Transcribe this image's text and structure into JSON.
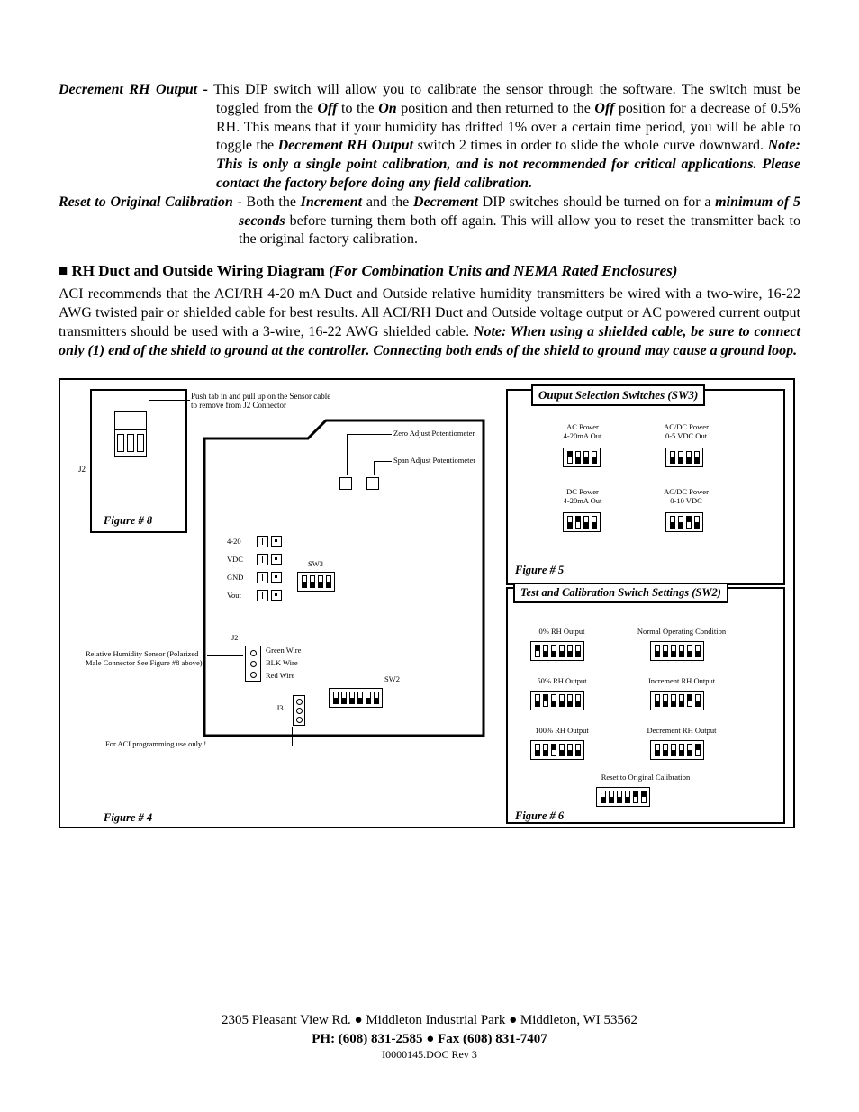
{
  "p1": {
    "label": "Decrement RH Output -",
    "t1": " This DIP switch will allow you to calibrate the sensor through the software.  The switch must be toggled from the ",
    "off1": "Off",
    "t2": " to the ",
    "on1": "On",
    "t3": " position and then returned to the ",
    "off2": "Off",
    "t4": " position for a decrease of 0.5% RH.  This means that if your humidity has drifted 1% over a certain time period, you will be able to toggle the ",
    "dec": "Decrement RH Output",
    "t5": " switch 2 times in order to slide the whole curve downward.  ",
    "note": "Note:  This is only a single point calibration, and is not recommended for critical applications.  Please contact the factory before doing any field  calibration."
  },
  "p2": {
    "label": "Reset to Original Calibration -",
    "t1": " Both the ",
    "inc": "Increment",
    "t2": " and the ",
    "dec": "Decrement",
    "t3": " DIP switches should be turned on for a ",
    "min": "minimum of 5 seconds",
    "t4": " before turning them both off again.  This will allow you to reset the transmitter back to the original factory calibration."
  },
  "heading": {
    "bullet": "■",
    "title": " RH Duct and Outside Wiring Diagram ",
    "sub": "(For Combination Units and NEMA Rated Enclosures)"
  },
  "p3": {
    "t1": "ACI recommends that the ACI/RH 4-20 mA Duct and Outside relative humidity transmitters be wired with a two-wire, 16-22 AWG twisted pair or shielded cable for best results.  All ACI/RH Duct and Outside voltage output or AC powered current output transmitters should be used with a 3-wire, 16-22 AWG shielded cable.  ",
    "note": "Note:  When using a shielded cable, be sure to connect only (1) end of the shield to ground at the controller.  Connecting both ends of the shield to ground may cause a ground loop."
  },
  "diagram": {
    "push_tab": "Push tab in and pull up on the Sensor cable to remove from J2 Connector",
    "zero": "Zero Adjust Potentiometer",
    "span": "Span Adjust Potentiometer",
    "j2": "J2",
    "fig8": "Figure # 8",
    "t420": "4-20",
    "vdc": "VDC",
    "gnd": "GND",
    "vout": "Vout",
    "sw3": "SW3",
    "sw2": "SW2",
    "j3": "J3",
    "green": "Green Wire",
    "blk": "BLK Wire",
    "red": "Red Wire",
    "rh_sensor": "Relative Humidity Sensor (Polarized Male Connector See Figure #8 above)",
    "aci_prog": "For ACI programming use only !",
    "fig4": "Figure # 4",
    "panel5": {
      "title": "Output Selection Switches (SW3)",
      "r1c1a": "AC Power",
      "r1c1b": "4-20mA Out",
      "r1c2a": "AC/DC Power",
      "r1c2b": "0-5 VDC Out",
      "r2c1a": "DC Power",
      "r2c1b": "4-20mA Out",
      "r2c2a": "AC/DC Power",
      "r2c2b": "0-10 VDC",
      "fig": "Figure # 5"
    },
    "panel6": {
      "title": "Test and Calibration Switch Settings (SW2)",
      "r1c1": "0% RH Output",
      "r1c2": "Normal Operating Condition",
      "r2c1": "50% RH Output",
      "r2c2": "Increment RH Output",
      "r3c1": "100% RH Output",
      "r3c2": "Decrement RH Output",
      "reset": "Reset to Original Calibration",
      "fig": "Figure # 6"
    }
  },
  "footer": {
    "addr1": "2305 Pleasant View Rd. ",
    "addr2": " Middleton Industrial Park ",
    "addr3": " Middleton, WI 53562",
    "ph": "PH: (608) 831-2585 ",
    "fax": " Fax (608) 831-7407",
    "rev": "I0000145.DOC Rev 3"
  },
  "chart_data": {
    "type": "table",
    "title": "DIP Switch Reference (SW3 Output Selection & SW2 Test/Calibration)",
    "sw3_outputs_4position": [
      {
        "label": "AC Power 4-20mA Out",
        "positions": [
          "up",
          "dn",
          "dn",
          "dn"
        ]
      },
      {
        "label": "AC/DC Power 0-5 VDC Out",
        "positions": [
          "dn",
          "dn",
          "dn",
          "dn"
        ]
      },
      {
        "label": "DC Power 4-20mA Out",
        "positions": [
          "dn",
          "up",
          "dn",
          "dn"
        ]
      },
      {
        "label": "AC/DC Power 0-10 VDC",
        "positions": [
          "dn",
          "dn",
          "up",
          "dn"
        ]
      }
    ],
    "sw2_test_cal_6position": [
      {
        "label": "0% RH Output",
        "positions": [
          "up",
          "dn",
          "dn",
          "dn",
          "dn",
          "dn"
        ]
      },
      {
        "label": "Normal Operating Condition",
        "positions": [
          "dn",
          "dn",
          "dn",
          "dn",
          "dn",
          "dn"
        ]
      },
      {
        "label": "50% RH Output",
        "positions": [
          "dn",
          "up",
          "dn",
          "dn",
          "dn",
          "dn"
        ]
      },
      {
        "label": "Increment RH Output",
        "positions": [
          "dn",
          "dn",
          "dn",
          "dn",
          "up",
          "dn"
        ]
      },
      {
        "label": "100% RH Output",
        "positions": [
          "dn",
          "dn",
          "up",
          "dn",
          "dn",
          "dn"
        ]
      },
      {
        "label": "Decrement RH Output",
        "positions": [
          "dn",
          "dn",
          "dn",
          "dn",
          "dn",
          "up"
        ]
      },
      {
        "label": "Reset to Original Calibration",
        "positions": [
          "dn",
          "dn",
          "dn",
          "dn",
          "up",
          "up"
        ]
      }
    ]
  }
}
